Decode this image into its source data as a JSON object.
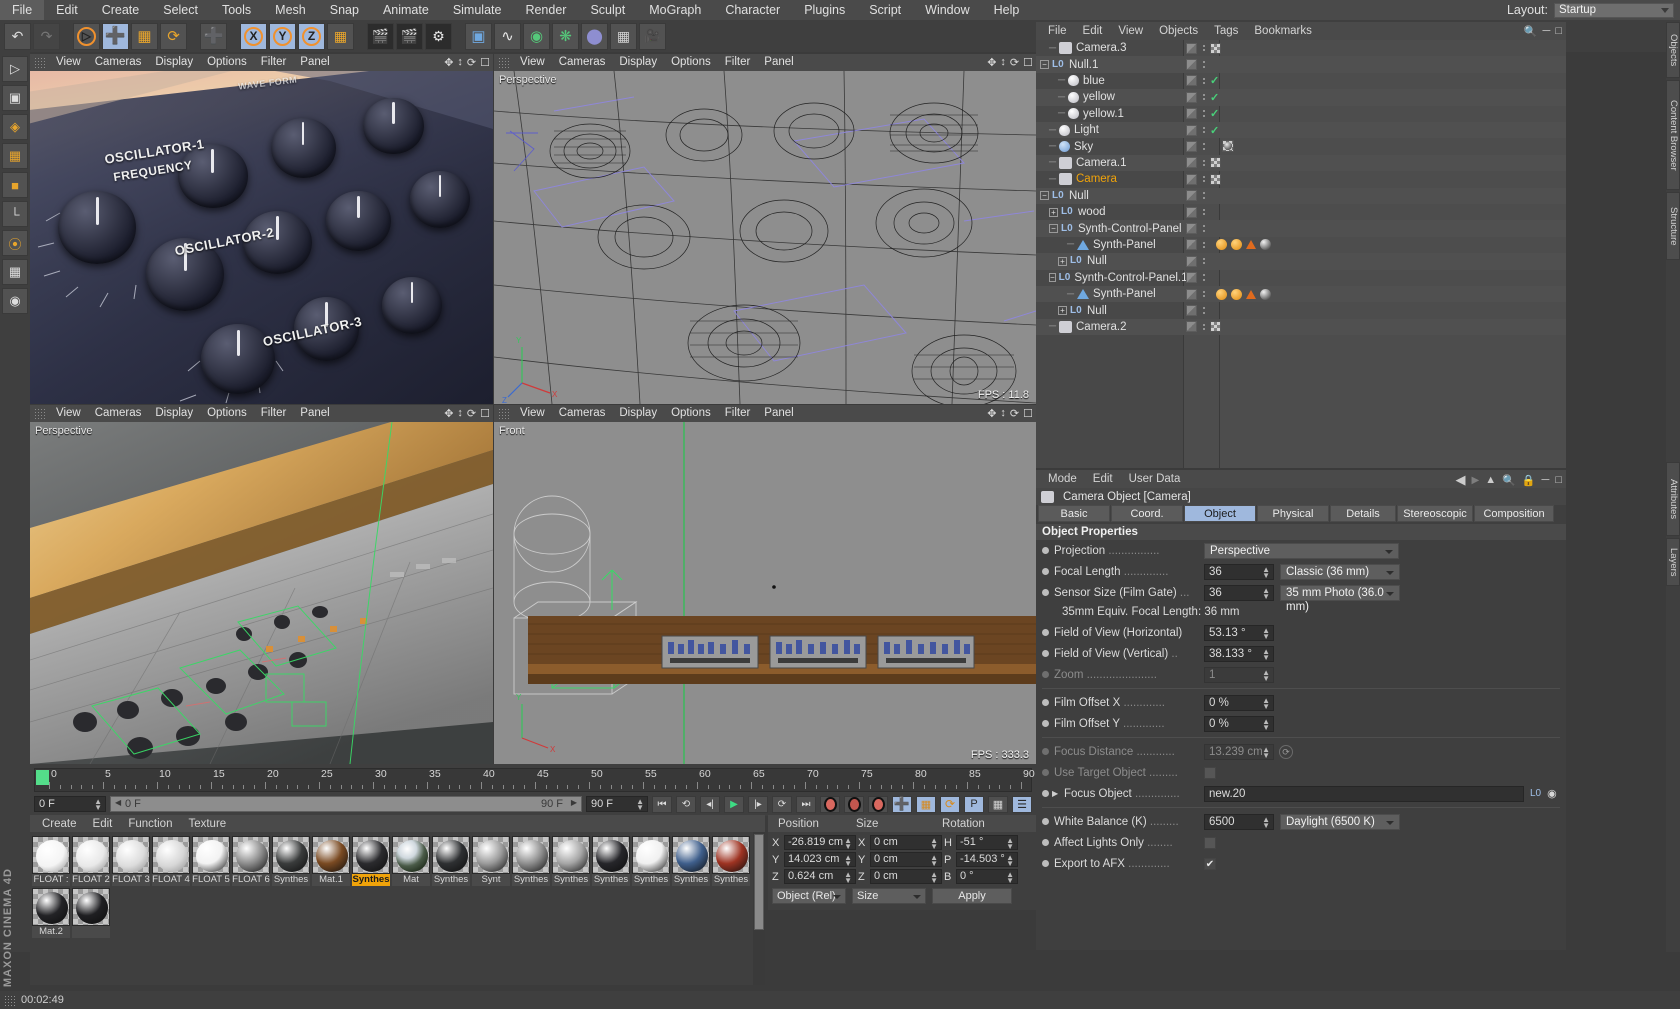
{
  "app": {
    "name": "MAXON CINEMA 4D",
    "status_time": "00:02:49"
  },
  "menubar": {
    "items": [
      "File",
      "Edit",
      "Create",
      "Select",
      "Tools",
      "Mesh",
      "Snap",
      "Animate",
      "Simulate",
      "Render",
      "Sculpt",
      "MoGraph",
      "Character",
      "Plugins",
      "Script",
      "Window",
      "Help"
    ],
    "layout_label": "Layout:",
    "layout_value": "Startup"
  },
  "viewports": [
    {
      "menu": [
        "View",
        "Cameras",
        "Display",
        "Options",
        "Filter",
        "Panel"
      ],
      "label": "",
      "fps": "",
      "texts": [
        "OSCILLATOR-1",
        "FREQUENCY",
        "OSCILLATOR-2",
        "OSCILLATOR-3",
        "WAVE FORM"
      ]
    },
    {
      "menu": [
        "View",
        "Cameras",
        "Display",
        "Options",
        "Filter",
        "Panel"
      ],
      "label": "Perspective",
      "fps": "FPS : 11.8",
      "texts": []
    },
    {
      "menu": [
        "View",
        "Cameras",
        "Display",
        "Options",
        "Filter",
        "Panel"
      ],
      "label": "Perspective",
      "fps": "",
      "texts": []
    },
    {
      "menu": [
        "View",
        "Cameras",
        "Display",
        "Options",
        "Filter",
        "Panel"
      ],
      "label": "Front",
      "fps": "FPS : 333.3",
      "texts": []
    }
  ],
  "timeline": {
    "numbers": [
      "0",
      "5",
      "10",
      "15",
      "20",
      "25",
      "30",
      "35",
      "40",
      "45",
      "50",
      "55",
      "60",
      "65",
      "70",
      "75",
      "80",
      "85",
      "90"
    ],
    "current_frame_field": "0 F",
    "range_start": "0 F",
    "range_end": "90 F",
    "end_field": "90 F",
    "right_field": "0 F"
  },
  "material_manager": {
    "menu": [
      "Create",
      "Edit",
      "Function",
      "Texture"
    ],
    "materials": [
      {
        "name": "FLOAT :",
        "color": "#f4f4f4",
        "kind": "noise-light"
      },
      {
        "name": "FLOAT 2",
        "color": "#e8e8e8",
        "kind": "noise"
      },
      {
        "name": "FLOAT 3",
        "color": "#dcdcdc",
        "kind": "noise"
      },
      {
        "name": "FLOAT 4",
        "color": "#d6d6d6",
        "kind": "noise"
      },
      {
        "name": "FLOAT 5",
        "color": "#f2f2f2",
        "kind": "solid"
      },
      {
        "name": "FLOAT 6",
        "color": "#8d8d8d",
        "kind": "solid"
      },
      {
        "name": "Synthes",
        "color": "#3a3c3c",
        "kind": "solid"
      },
      {
        "name": "Mat.1",
        "color": "#7a4a22",
        "kind": "solid"
      },
      {
        "name": "Synthes",
        "color": "#2b2b2e",
        "kind": "speckle",
        "selected": true
      },
      {
        "name": "Mat",
        "color": "#b8c4ce",
        "kind": "reflective"
      },
      {
        "name": "Synthes",
        "color": "#2e3032",
        "kind": "solid"
      },
      {
        "name": "Synt",
        "color": "#9b9b9b",
        "kind": "solid"
      },
      {
        "name": "Synthes",
        "color": "#8f8f8f",
        "kind": "solid"
      },
      {
        "name": "Synthes",
        "color": "#a6a6a6",
        "kind": "solid"
      },
      {
        "name": "Synthes",
        "color": "#26262a",
        "kind": "solid"
      },
      {
        "name": "Synthes",
        "color": "#f0f0f0",
        "kind": "solid"
      },
      {
        "name": "Synthes",
        "color": "#3f5f8c",
        "kind": "solid"
      },
      {
        "name": "Synthes",
        "color": "#9e3322",
        "kind": "solid"
      },
      {
        "name": "Mat.2",
        "color": "#232326",
        "kind": "solid"
      },
      {
        "name": "",
        "color": "#1f1f22",
        "kind": "solid"
      }
    ]
  },
  "coordinates": {
    "menu_title": "",
    "columns": [
      "Position",
      "Size",
      "Rotation"
    ],
    "position": {
      "X": "-26.819 cm",
      "Y": "14.023 cm",
      "Z": "0.624 cm"
    },
    "size": {
      "X": "0 cm",
      "Y": "0 cm",
      "Z": "0 cm"
    },
    "rotation": {
      "H": "-51 °",
      "P": "-14.503 °",
      "B": "0 °"
    },
    "rot_axes": [
      "H",
      "P",
      "B"
    ],
    "pos_axes": [
      "X",
      "Y",
      "Z"
    ],
    "mode_select": "Object (Rel)",
    "size_select": "Size",
    "apply_button": "Apply"
  },
  "object_manager": {
    "menu": [
      "File",
      "Edit",
      "View",
      "Objects",
      "Tags",
      "Bookmarks"
    ],
    "rows": [
      {
        "label": "Camera.3",
        "indent": 1,
        "icon": "camera-icon",
        "expander": "none",
        "tags": [
          "grey",
          "dots",
          "xform"
        ]
      },
      {
        "label": "Null.1",
        "indent": 0,
        "icon": "null-icon",
        "expander": "minus",
        "tags": [
          "grey",
          "dots"
        ]
      },
      {
        "label": "blue",
        "indent": 2,
        "icon": "light-icon",
        "expander": "none",
        "tags": [
          "grey",
          "dots",
          "check"
        ]
      },
      {
        "label": "yellow",
        "indent": 2,
        "icon": "light-icon",
        "expander": "none",
        "tags": [
          "grey",
          "dots",
          "check"
        ]
      },
      {
        "label": "yellow.1",
        "indent": 2,
        "icon": "light-icon",
        "expander": "none",
        "tags": [
          "grey",
          "dots",
          "check"
        ]
      },
      {
        "label": "Light",
        "indent": 1,
        "icon": "light-icon",
        "expander": "none",
        "tags": [
          "grey",
          "dots",
          "check"
        ]
      },
      {
        "label": "Sky",
        "indent": 1,
        "icon": "sky-icon",
        "expander": "none",
        "tags": [
          "grey",
          "dots"
        ],
        "extra": "skyball"
      },
      {
        "label": "Camera.1",
        "indent": 1,
        "icon": "camera-icon",
        "expander": "none",
        "tags": [
          "grey",
          "dots",
          "xform"
        ]
      },
      {
        "label": "Camera",
        "indent": 1,
        "icon": "camera-icon",
        "expander": "none",
        "tags": [
          "grey",
          "dots",
          "xform"
        ],
        "selected": true
      },
      {
        "label": "Null",
        "indent": 0,
        "icon": "null-icon",
        "expander": "minus",
        "tags": [
          "grey",
          "dots"
        ]
      },
      {
        "label": "wood",
        "indent": 1,
        "icon": "null-icon",
        "expander": "plus",
        "tags": [
          "grey",
          "dots"
        ]
      },
      {
        "label": "Synth-Control-Panel",
        "indent": 1,
        "icon": "null-icon",
        "expander": "minus",
        "tags": [
          "grey",
          "dots"
        ]
      },
      {
        "label": "Synth-Panel",
        "indent": 3,
        "icon": "poly-icon",
        "expander": "none",
        "tags": [
          "grey",
          "dots"
        ],
        "extra": "mat"
      },
      {
        "label": "Null",
        "indent": 2,
        "icon": "null-icon",
        "expander": "plus",
        "tags": [
          "grey",
          "dots"
        ]
      },
      {
        "label": "Synth-Control-Panel.1",
        "indent": 1,
        "icon": "null-icon",
        "expander": "minus",
        "tags": [
          "grey",
          "dots"
        ]
      },
      {
        "label": "Synth-Panel",
        "indent": 3,
        "icon": "poly-icon",
        "expander": "none",
        "tags": [
          "grey",
          "dots"
        ],
        "extra": "mat"
      },
      {
        "label": "Null",
        "indent": 2,
        "icon": "null-icon",
        "expander": "plus",
        "tags": [
          "grey",
          "dots"
        ]
      },
      {
        "label": "Camera.2",
        "indent": 1,
        "icon": "camera-icon",
        "expander": "none",
        "tags": [
          "grey",
          "dots",
          "xform"
        ]
      }
    ]
  },
  "attribute_manager": {
    "menu": [
      "Mode",
      "Edit",
      "User Data"
    ],
    "object_title": "Camera Object [Camera]",
    "tabs": [
      "Basic",
      "Coord.",
      "Object",
      "Physical",
      "Details",
      "Stereoscopic",
      "Composition"
    ],
    "active_tab": "Object",
    "section_title": "Object Properties",
    "fields": [
      {
        "label": "Projection",
        "type": "select",
        "value": "Perspective",
        "width": 195,
        "dim": false
      },
      {
        "label": "Focal Length",
        "type": "num-select",
        "value": "36",
        "select": "Classic (36 mm)",
        "dim": false
      },
      {
        "label": "Sensor Size (Film Gate)",
        "type": "num-select",
        "value": "36",
        "select": "35 mm Photo (36.0 mm)",
        "dim": false
      },
      {
        "label": "35mm Equiv. Focal Length:  36 mm",
        "type": "hint",
        "dim": false
      },
      {
        "label": "Field of View (Horizontal)",
        "type": "num",
        "value": "53.13 °",
        "dim": false
      },
      {
        "label": "Field of View (Vertical)",
        "type": "num",
        "value": "38.133 °",
        "dim": false
      },
      {
        "label": "Zoom",
        "type": "num",
        "value": "1",
        "dim": true
      },
      {
        "label": "Film Offset X",
        "type": "num",
        "value": "0 %",
        "dim": false
      },
      {
        "label": "Film Offset Y",
        "type": "num",
        "value": "0 %",
        "dim": false
      },
      {
        "label": "Focus Distance",
        "type": "num-icon",
        "value": "13.239 cm",
        "dim": true
      },
      {
        "label": "Use Target Object",
        "type": "check",
        "value": "",
        "dim": true
      },
      {
        "label": "Focus Object",
        "type": "linkbox",
        "value": "new.20",
        "dim": false
      },
      {
        "label": "White Balance (K)",
        "type": "num-select",
        "value": "6500",
        "select": "Daylight (6500 K)",
        "dim": false
      },
      {
        "label": "Affect Lights Only",
        "type": "check",
        "value": "",
        "dim": false
      },
      {
        "label": "Export to AFX",
        "type": "check",
        "value": "✔",
        "dim": false
      }
    ]
  },
  "right_tabs": [
    "Objects",
    "Content Browser",
    "Structure",
    "Attributes",
    "Layers"
  ],
  "left_tools": [
    "select-icon",
    "move-icon",
    "scale-icon",
    "rotate-icon",
    "cube-icon",
    "spline-icon",
    "deform-icon",
    "magnet-icon",
    "texture-icon",
    "paint-icon"
  ],
  "toolbar": {
    "groups": [
      [
        "undo-icon",
        "redo-icon"
      ],
      [
        "select-live-icon",
        "move-icon",
        "scale-icon",
        "rotate-icon"
      ],
      [
        "coord-system-icon"
      ],
      [
        "axis-x-icon",
        "axis-y-icon",
        "axis-z-icon",
        "world-icon"
      ],
      [
        "render-view-icon",
        "render-picture-icon",
        "render-settings-icon"
      ],
      [
        "cube-icon",
        "spline-icon",
        "generator-icon",
        "deformer-icon",
        "scene-icon",
        "environment-icon",
        "camera-icon"
      ]
    ],
    "axis_labels": [
      "X",
      "Y",
      "Z"
    ]
  },
  "colors": {
    "accent_orange": "#f0a30a",
    "tab_active_blue": "#9fb8dd",
    "check_green": "#49d07a",
    "play_green": "#3ddc84"
  }
}
